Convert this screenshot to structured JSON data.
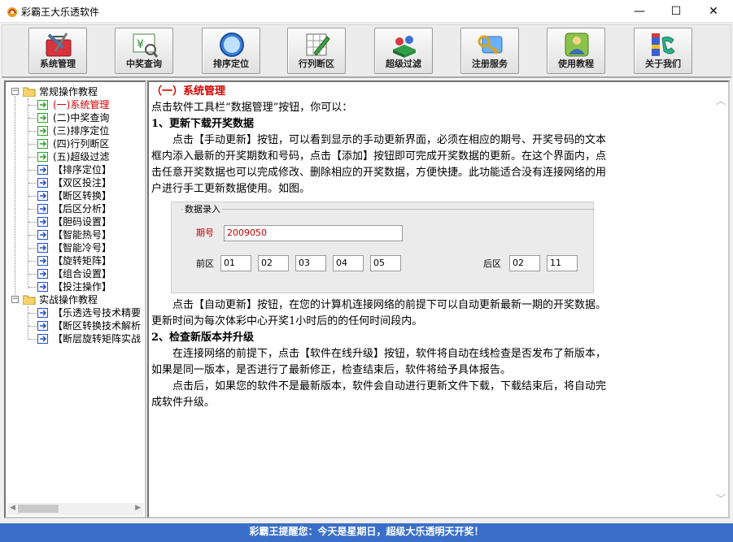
{
  "window": {
    "title": "彩霸王大乐透软件",
    "controls": {
      "minimize": "—",
      "maximize": "☐",
      "close": "✕"
    }
  },
  "toolbar": {
    "buttons": [
      {
        "label": "系统管理",
        "icon": "toolbox-icon"
      },
      {
        "label": "中奖查询",
        "icon": "lottery-ticket-icon"
      },
      {
        "label": "排序定位",
        "icon": "compass-icon"
      },
      {
        "label": "行列断区",
        "icon": "grid-pencil-icon"
      },
      {
        "label": "超级过滤",
        "icon": "filter-icon"
      },
      {
        "label": "注册服务",
        "icon": "key-icon"
      },
      {
        "label": "使用教程",
        "icon": "help-user-icon"
      },
      {
        "label": "关于我们",
        "icon": "phone-icon"
      }
    ]
  },
  "tree": {
    "groups": [
      {
        "label": "常规操作教程",
        "expander": "−",
        "items": [
          "(一)系统管理",
          "(二)中奖查询",
          "(三)排序定位",
          "(四)行列断区",
          "(五)超级过滤",
          "【排序定位】",
          "【双区投注】",
          "【断区转换】",
          "【后区分析】",
          "【胆码设置】",
          "【智能热号】",
          "【智能冷号】",
          "【旋转矩阵】",
          "【组合设置】",
          "【投注操作】"
        ]
      },
      {
        "label": "实战操作教程",
        "expander": "−",
        "items": [
          "【乐透选号技术精要",
          "【断区转换技术解析",
          "【断层旋转矩阵实战"
        ]
      }
    ],
    "selected": "(一)系统管理",
    "accent_green": "#2aa12a",
    "accent_blue": "#1f4fd0"
  },
  "content": {
    "heading": "（一）系统管理",
    "intro": "点击软件工具栏“数据管理”按钮，你可以：",
    "section1_title": "1、更新下载开奖数据",
    "section1_para": "点击【手动更新】按钮，可以看到显示的手动更新界面，必须在相应的期号、开奖号码的文本框内添入最新的开奖期数和号码，点击【添加】按钮即可完成开奖数据的更新。在这个界面内，点击任意开奖数据也可以完成修改、删除相应的开奖数据，方便快捷。此功能适合没有连接网络的用户进行手工更新数据使用。如图。",
    "entry_panel": {
      "legend": "数据录入",
      "qihao_label": "期号",
      "qihao_value": "2009050",
      "front_label": "前区",
      "front_values": [
        "01",
        "02",
        "03",
        "04",
        "05"
      ],
      "back_label": "后区",
      "back_values": [
        "02",
        "11"
      ]
    },
    "auto_update_para": "点击【自动更新】按钮，在您的计算机连接网络的前提下可以自动更新最新一期的开奖数据。更新时间为每次体彩中心开奖1小时后的的任何时间段内。",
    "section2_title": "2、检查新版本并升级",
    "section2_para1": "在连接网络的前提下，点击【软件在线升级】按钮，软件将自动在线检查是否发布了新版本，如果是同一版本，是否进行了最新修正，检查结束后，软件将给予具体报告。",
    "section2_para2": "点击后，如果您的软件不是最新版本，软件会自动进行更新文件下载，下载结束后，将自动完成软件升级。"
  },
  "statusbar": {
    "text": "彩霸王提醒您：今天是星期日，超级大乐透明天开奖！"
  }
}
